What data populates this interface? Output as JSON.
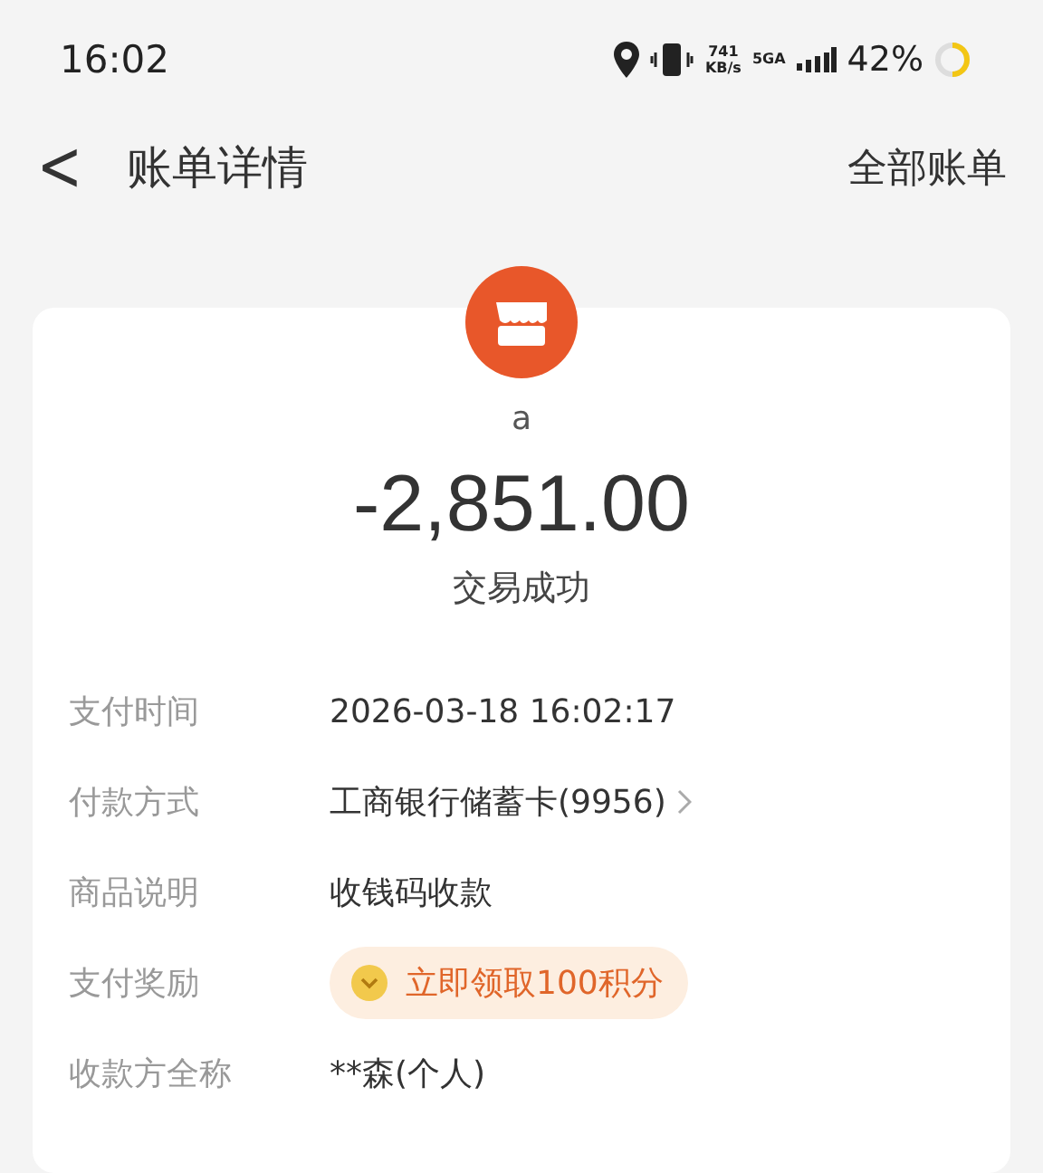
{
  "status_bar": {
    "time": "16:02",
    "net_speed": "741",
    "net_unit": "KB/s",
    "network": "5GA",
    "battery": "42%"
  },
  "nav": {
    "back": "<",
    "title": "账单详情",
    "action": "全部账单"
  },
  "summary": {
    "merchant": "a",
    "amount": "-2,851.00",
    "status": "交易成功"
  },
  "rows": [
    {
      "kind": "text",
      "label": "支付时间",
      "value": "2026-03-18 16:02:17"
    },
    {
      "kind": "link",
      "label": "付款方式",
      "value": "工商银行储蓄卡(9956)"
    },
    {
      "kind": "text",
      "label": "商品说明",
      "value": "收钱码收款"
    },
    {
      "kind": "badge",
      "label": "支付奖励",
      "value": "立即领取100积分"
    },
    {
      "kind": "text",
      "label": "收款方全称",
      "value": "**森(个人)"
    }
  ]
}
